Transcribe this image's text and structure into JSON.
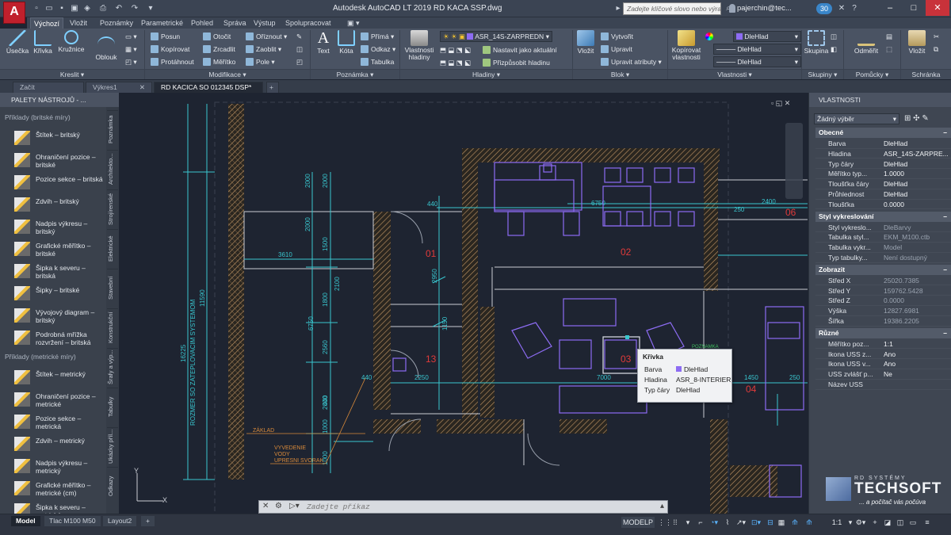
{
  "app": {
    "logo_letter": "A",
    "logo_sub": "LT",
    "title": "Autodesk AutoCAD LT 2019   RD KACA SSP.dwg",
    "search_placeholder": "Zadejte klíčové slovo nebo výraz",
    "user": "pajerchin@tec...",
    "badge_count": "30"
  },
  "ribbon_tabs": [
    {
      "label": "Výchozí",
      "active": true
    },
    {
      "label": "Vložit"
    },
    {
      "label": "Poznámky"
    },
    {
      "label": "Parametrické"
    },
    {
      "label": "Pohled"
    },
    {
      "label": "Správa"
    },
    {
      "label": "Výstup"
    },
    {
      "label": "Spolupracovat"
    }
  ],
  "ribbon": {
    "draw": {
      "title": "Kreslit",
      "line": "Úsečka",
      "polyline": "Křivka",
      "circle": "Kružnice",
      "arc": "Oblouk"
    },
    "modify": {
      "title": "Modifikace",
      "move": "Posun",
      "rotate": "Otočit",
      "trim": "Oříznout",
      "copy": "Kopírovat",
      "mirror": "Zrcadlit",
      "fillet": "Zaoblit",
      "stretch": "Protáhnout",
      "scale": "Měřítko",
      "array": "Pole"
    },
    "annot": {
      "title": "Poznámka",
      "text": "Text",
      "dim": "Kóta",
      "linear": "Přímá",
      "leader": "Odkaz",
      "table": "Tabulka"
    },
    "layers": {
      "title": "Hladiny",
      "props": "Vlastnosti hladiny",
      "current": "ASR_14S-ZARPREDN",
      "make_current": "Nastavit jako aktuální",
      "match": "Přizpůsobit hladinu"
    },
    "block": {
      "title": "Blok",
      "insert": "Vložit",
      "create": "Vytvořit",
      "edit": "Upravit",
      "edit_attr": "Upravit atributy"
    },
    "properties": {
      "title": "Vlastnosti",
      "match": "Kopírovat vlastnosti",
      "color": "DleHlad",
      "linetype": "DleHlad",
      "lineweight": "DleHlad"
    },
    "groups": {
      "title": "Skupiny",
      "group": "Skupina"
    },
    "utils": {
      "title": "Pomůcky",
      "measure": "Odměřit"
    },
    "clip": {
      "title": "Schránka",
      "paste": "Vložit"
    }
  },
  "doc_tabs": [
    {
      "label": "Začít"
    },
    {
      "label": "Výkres1"
    },
    {
      "label": "RD KACICA SO 012345 DSP*",
      "active": true
    }
  ],
  "palette": {
    "title": "PALETY NÁSTROJŮ - ...",
    "sec1": "Příklady (britské míry)",
    "items1": [
      "Štítek – britský",
      "Ohraničení pozice – britské",
      "Pozice sekce – britská",
      "Zdvih – britský",
      "Nadpis výkresu – britský",
      "Grafické měřítko – britské",
      "Šipka k severu – britská",
      "Šipky – britské",
      "Vývojový diagram – britský",
      "Podrobná mřížka rozvržení – britská"
    ],
    "sec2": "Příklady (metrické míry)",
    "items2": [
      "Štítek – metrický",
      "Ohraničení pozice – metrické",
      "Pozice sekce – metrická",
      "Zdvih – metrický",
      "Nadpis výkresu – metrický",
      "Grafické měřítko – metrické (cm)",
      "Šipka k severu – metrická"
    ],
    "vtabs": [
      "Poznámka",
      "Architekto...",
      "Strojírenské",
      "Elektrické",
      "Stavební",
      "Konstrukční",
      "Šrafy a výp...",
      "Tabulky",
      "Ukázky příl...",
      "Odkazy"
    ]
  },
  "drawing": {
    "rooms": [
      "01",
      "02",
      "13",
      "03",
      "04",
      "06"
    ],
    "dims": [
      "2000",
      "2000",
      "3610",
      "2000",
      "1500",
      "2100",
      "1800",
      "6750",
      "2950",
      "1150",
      "2560",
      "2000",
      "1000",
      "440",
      "440",
      "1000",
      "16225",
      "11590",
      "6750",
      "250",
      "2400",
      "2250",
      "7000",
      "1450",
      "250",
      "440"
    ],
    "vertical_note": "ROZMER SO ZATEPLOVACIM SYSTEMOM",
    "annotation1": "ZÁKLAD",
    "annotation2": [
      "VYVEDENIE",
      "VODY",
      "UPRESNI SVORAK"
    ],
    "label_green": "POZNAMKA"
  },
  "tooltip": {
    "title": "Křivka",
    "rows": [
      [
        "Barva",
        "DleHlad"
      ],
      [
        "Hladina",
        "ASR_8-INTERIER"
      ],
      [
        "Typ čáry",
        "DleHlad"
      ]
    ]
  },
  "command": {
    "placeholder": "Zadejte příkaz"
  },
  "properties": {
    "title": "VLASTNOSTI",
    "selection": "Žádný výběr",
    "general": {
      "title": "Obecné",
      "rows": [
        [
          "Barva",
          "DleHlad"
        ],
        [
          "Hladina",
          "ASR_14S-ZARPRE..."
        ],
        [
          "Typ čáry",
          "DleHlad"
        ],
        [
          "Měřítko typ...",
          "1.0000"
        ],
        [
          "Tloušťka čáry",
          "DleHlad"
        ],
        [
          "Průhlednost",
          "DleHlad"
        ],
        [
          "Tloušťka",
          "0.0000"
        ]
      ]
    },
    "plotstyle": {
      "title": "Styl vykreslování",
      "rows": [
        [
          "Styl vykreslo...",
          "DleBarvy"
        ],
        [
          "Tabulka styl...",
          "EKM_M100.ctb"
        ],
        [
          "Tabulka vykr...",
          "Model"
        ],
        [
          "Typ tabulky...",
          "Není dostupný"
        ]
      ]
    },
    "view": {
      "title": "Zobrazit",
      "rows": [
        [
          "Střed X",
          "25020.7385"
        ],
        [
          "Střed Y",
          "159762.5428"
        ],
        [
          "Střed Z",
          "0.0000"
        ],
        [
          "Výška",
          "12827.6981"
        ],
        [
          "Šířka",
          "19386.2205"
        ]
      ]
    },
    "misc": {
      "title": "Různé",
      "rows": [
        [
          "Měřítko poz...",
          "1:1"
        ],
        [
          "Ikona USS z...",
          "Ano"
        ],
        [
          "Ikona USS v...",
          "Ano"
        ],
        [
          "USS zvlášť p...",
          "Ne"
        ],
        [
          "Název USS",
          ""
        ]
      ]
    }
  },
  "status": {
    "layout_tabs": [
      "Model",
      "Tlac M100 M50",
      "Layout2"
    ],
    "model_btn": "MODELP",
    "scale": "1:1"
  },
  "brand": {
    "line1": "TECHSOFT",
    "line2": "... a počítač vás počúva",
    "tag": "RD SYSTÉMY"
  },
  "colors": {
    "accent_cyan": "#39c6cf",
    "room_red": "#e03a3a",
    "furniture": "#8d6cf3",
    "hatch": "#c49766"
  }
}
